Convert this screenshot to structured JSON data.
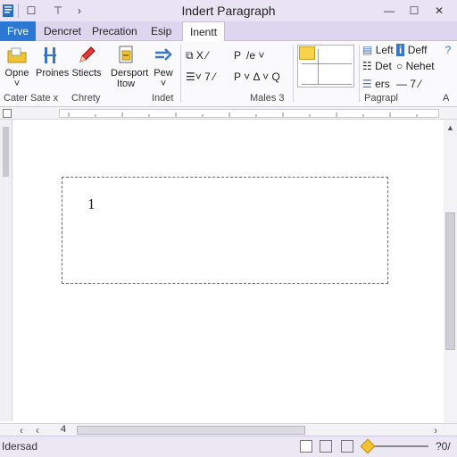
{
  "window": {
    "title": "Indert Paragraph",
    "controls": {
      "minimize": "—",
      "maximize": "☐",
      "close": "✕"
    },
    "quick_access": [
      "☐",
      "⊤",
      "›"
    ],
    "help_icon": "?"
  },
  "tabs": [
    {
      "label": "Frve",
      "kind": "file"
    },
    {
      "label": "Dencret"
    },
    {
      "label": "Precation"
    },
    {
      "label": "Esip"
    },
    {
      "label": "Inentt",
      "kind": "active"
    }
  ],
  "ribbon": {
    "big_buttons": [
      {
        "label": "Opne",
        "sub": "˅"
      },
      {
        "label": "Proines",
        "sub": ""
      },
      {
        "label": "Stiects",
        "sub": ""
      },
      {
        "label": "Dersport",
        "sub": "Itow"
      },
      {
        "label": "Pew",
        "sub": "˅"
      }
    ],
    "font_row1": [
      "⧉ X ⁄",
      "P",
      "/e ˅"
    ],
    "font_row2": [
      "☰˅ 7 ⁄",
      "P ˅ Δ ˅ Q"
    ],
    "para_left": [
      "Left",
      "Det",
      "ers"
    ],
    "para_right": [
      "Deff",
      "Nehet",
      "— 7 ⁄"
    ],
    "group_labels": [
      "Cater Sate x",
      "Chrety",
      "Indet",
      "Males 3",
      "Pagrapl",
      "A"
    ]
  },
  "document": {
    "text": "1"
  },
  "hscroll": {
    "left_arrow": "‹",
    "page": "4",
    "right_arrow": "›"
  },
  "status": {
    "left": "Idersad",
    "zoom": "?0/"
  },
  "colors": {
    "accent": "#2b78d4",
    "title_bg": "#e9e3f3",
    "tab_bg": "#ded6ee",
    "zoom_thumb": "#f2c230"
  }
}
